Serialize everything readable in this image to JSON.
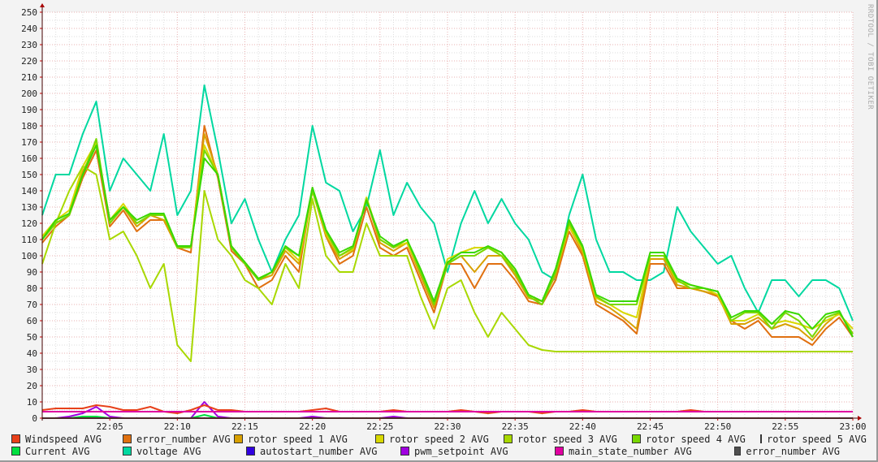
{
  "chart_data": {
    "type": "line",
    "title": "",
    "watermark": "RRDTOOL / TOBI OETIKER",
    "ylim": [
      0,
      250
    ],
    "yticks": [
      0,
      10,
      20,
      30,
      40,
      50,
      60,
      70,
      80,
      90,
      100,
      110,
      120,
      130,
      140,
      150,
      160,
      170,
      180,
      190,
      200,
      210,
      220,
      230,
      240,
      250
    ],
    "xlim_minutes": [
      0,
      60
    ],
    "xticks": [
      {
        "m": 5,
        "label": "22:05"
      },
      {
        "m": 10,
        "label": "22:10"
      },
      {
        "m": 15,
        "label": "22:15"
      },
      {
        "m": 20,
        "label": "22:20"
      },
      {
        "m": 25,
        "label": "22:25"
      },
      {
        "m": 30,
        "label": "22:30"
      },
      {
        "m": 35,
        "label": "22:35"
      },
      {
        "m": 40,
        "label": "22:40"
      },
      {
        "m": 45,
        "label": "22:45"
      },
      {
        "m": 50,
        "label": "22:50"
      },
      {
        "m": 55,
        "label": "22:55"
      },
      {
        "m": 60,
        "label": "23:00"
      }
    ],
    "grid": true,
    "x_minutes_step": 1,
    "series": [
      {
        "name": "Windspeed AVG",
        "color": "#e8401a",
        "values": [
          5,
          6,
          6,
          6,
          8,
          7,
          5,
          5,
          7,
          4,
          3,
          5,
          8,
          5,
          5,
          4,
          4,
          4,
          4,
          4,
          5,
          6,
          4,
          4,
          4,
          4,
          5,
          4,
          4,
          4,
          4,
          5,
          4,
          3,
          4,
          4,
          4,
          3,
          4,
          4,
          5,
          4,
          4,
          4,
          4,
          4,
          4,
          4,
          5,
          4,
          4,
          4,
          4,
          4,
          4,
          4,
          4,
          4,
          4,
          4,
          4
        ]
      },
      {
        "name": "error_number AVG",
        "color": "#e07010",
        "values": [
          108,
          118,
          125,
          148,
          165,
          118,
          128,
          115,
          122,
          122,
          105,
          102,
          180,
          148,
          103,
          95,
          80,
          85,
          100,
          90,
          142,
          112,
          95,
          100,
          130,
          105,
          100,
          105,
          85,
          65,
          95,
          95,
          80,
          95,
          95,
          85,
          72,
          70,
          85,
          115,
          100,
          70,
          65,
          60,
          52,
          95,
          95,
          80,
          80,
          78,
          75,
          60,
          55,
          60,
          50,
          50,
          50,
          45,
          55,
          62,
          50
        ]
      },
      {
        "name": "rotor speed 1 AVG",
        "color": "#d8a000",
        "values": [
          112,
          120,
          125,
          152,
          168,
          120,
          130,
          118,
          125,
          122,
          105,
          105,
          175,
          150,
          105,
          95,
          85,
          88,
          103,
          95,
          140,
          112,
          98,
          103,
          135,
          108,
          103,
          108,
          88,
          68,
          95,
          100,
          90,
          100,
          100,
          88,
          74,
          72,
          88,
          118,
          102,
          72,
          68,
          62,
          55,
          98,
          98,
          82,
          80,
          78,
          76,
          58,
          58,
          62,
          55,
          58,
          55,
          48,
          58,
          65,
          52
        ]
      },
      {
        "name": "rotor speed 2 AVG",
        "color": "#d8d800",
        "values": [
          112,
          122,
          128,
          155,
          170,
          122,
          132,
          120,
          125,
          125,
          106,
          106,
          168,
          150,
          106,
          96,
          86,
          90,
          105,
          97,
          140,
          114,
          100,
          104,
          136,
          110,
          105,
          108,
          90,
          70,
          98,
          102,
          105,
          105,
          102,
          90,
          76,
          72,
          90,
          118,
          104,
          74,
          70,
          65,
          62,
          100,
          100,
          84,
          82,
          80,
          76,
          60,
          60,
          64,
          58,
          60,
          58,
          55,
          60,
          64,
          55
        ]
      },
      {
        "name": "rotor speed 3 AVG",
        "color": "#a8d800",
        "values": [
          95,
          120,
          140,
          155,
          150,
          110,
          115,
          100,
          80,
          95,
          45,
          35,
          140,
          110,
          100,
          85,
          80,
          70,
          95,
          80,
          135,
          100,
          90,
          90,
          120,
          100,
          100,
          100,
          75,
          55,
          80,
          85,
          65,
          50,
          65,
          55,
          45,
          42,
          41,
          41,
          41,
          41,
          41,
          41,
          41,
          41,
          41,
          41,
          41,
          41,
          41,
          41,
          41,
          41,
          41,
          41,
          41,
          41,
          41,
          41,
          41
        ]
      },
      {
        "name": "rotor speed 4 AVG",
        "color": "#78d800",
        "values": [
          110,
          120,
          125,
          150,
          172,
          120,
          130,
          120,
          125,
          125,
          105,
          105,
          165,
          150,
          105,
          95,
          85,
          90,
          105,
          100,
          140,
          115,
          100,
          105,
          135,
          110,
          105,
          110,
          90,
          70,
          95,
          100,
          100,
          105,
          100,
          90,
          75,
          70,
          90,
          120,
          105,
          75,
          70,
          70,
          70,
          100,
          100,
          85,
          80,
          80,
          78,
          60,
          65,
          65,
          55,
          65,
          60,
          50,
          62,
          65,
          52
        ]
      },
      {
        "name": "rotor speed 5 AVG",
        "color": "#38d800",
        "values": [
          110,
          122,
          126,
          150,
          168,
          122,
          130,
          122,
          126,
          126,
          106,
          106,
          160,
          150,
          106,
          96,
          86,
          90,
          106,
          100,
          142,
          116,
          102,
          106,
          134,
          112,
          106,
          110,
          92,
          72,
          96,
          102,
          102,
          106,
          102,
          92,
          76,
          72,
          92,
          122,
          106,
          76,
          72,
          72,
          72,
          102,
          102,
          86,
          82,
          80,
          78,
          62,
          66,
          66,
          58,
          66,
          64,
          55,
          64,
          66,
          50
        ]
      },
      {
        "name": "Current AVG",
        "color": "#00e040",
        "values": [
          0,
          0,
          0,
          1,
          1,
          0,
          0,
          0,
          0,
          0,
          0,
          0,
          2,
          0,
          0,
          0,
          0,
          0,
          0,
          0,
          0,
          0,
          0,
          0,
          0,
          0,
          0,
          0,
          0,
          0,
          0,
          0,
          0,
          0,
          0,
          0,
          0,
          0,
          0,
          0,
          0,
          0,
          0,
          0,
          0,
          0,
          0,
          0,
          0,
          0,
          0,
          0,
          0,
          0,
          0,
          0,
          0,
          0,
          0,
          0,
          0
        ]
      },
      {
        "name": "voltage AVG",
        "color": "#00d8a0",
        "values": [
          125,
          150,
          150,
          175,
          195,
          140,
          160,
          150,
          140,
          175,
          125,
          140,
          205,
          165,
          120,
          135,
          110,
          90,
          110,
          125,
          180,
          145,
          140,
          115,
          130,
          165,
          125,
          145,
          130,
          120,
          90,
          120,
          140,
          120,
          135,
          120,
          110,
          90,
          85,
          125,
          150,
          110,
          90,
          90,
          85,
          85,
          90,
          130,
          115,
          105,
          95,
          100,
          80,
          65,
          85,
          85,
          75,
          85,
          85,
          80,
          60
        ]
      },
      {
        "name": "autostart_number AVG",
        "color": "#3000e0",
        "values": [
          0,
          0,
          0,
          0,
          0,
          0,
          0,
          0,
          0,
          0,
          0,
          0,
          0,
          0,
          0,
          0,
          0,
          0,
          0,
          0,
          0,
          0,
          0,
          0,
          0,
          0,
          0,
          0,
          0,
          0,
          0,
          0,
          0,
          0,
          0,
          0,
          0,
          0,
          0,
          0,
          0,
          0,
          0,
          0,
          0,
          0,
          0,
          0,
          0,
          0,
          0,
          0,
          0,
          0,
          0,
          0,
          0,
          0,
          0,
          0,
          0
        ]
      },
      {
        "name": "pwm_setpoint AVG",
        "color": "#a000e0",
        "values": [
          0,
          0,
          1,
          3,
          7,
          1,
          0,
          0,
          0,
          0,
          0,
          0,
          10,
          1,
          0,
          0,
          0,
          0,
          0,
          0,
          1,
          0,
          0,
          0,
          0,
          0,
          1,
          0,
          0,
          0,
          0,
          0,
          0,
          0,
          0,
          0,
          0,
          0,
          0,
          0,
          0,
          0,
          0,
          0,
          0,
          0,
          0,
          0,
          0,
          0,
          0,
          0,
          0,
          0,
          0,
          0,
          0,
          0,
          0,
          0,
          0
        ]
      },
      {
        "name": "main_state_number AVG",
        "color": "#e000a0",
        "values": [
          4,
          4,
          4,
          4,
          4,
          4,
          4,
          4,
          4,
          4,
          4,
          4,
          4,
          4,
          4,
          4,
          4,
          4,
          4,
          4,
          4,
          4,
          4,
          4,
          4,
          4,
          4,
          4,
          4,
          4,
          4,
          4,
          4,
          4,
          4,
          4,
          4,
          4,
          4,
          4,
          4,
          4,
          4,
          4,
          4,
          4,
          4,
          4,
          4,
          4,
          4,
          4,
          4,
          4,
          4,
          4,
          4,
          4,
          4,
          4,
          4
        ]
      },
      {
        "name": "error_number AVG",
        "color": "#505050",
        "values": [
          0,
          0,
          0,
          0,
          0,
          0,
          0,
          0,
          0,
          0,
          0,
          0,
          0,
          0,
          0,
          0,
          0,
          0,
          0,
          0,
          0,
          0,
          0,
          0,
          0,
          0,
          0,
          0,
          0,
          0,
          0,
          0,
          0,
          0,
          0,
          0,
          0,
          0,
          0,
          0,
          0,
          0,
          0,
          0,
          0,
          0,
          0,
          0,
          0,
          0,
          0,
          0,
          0,
          0,
          0,
          0,
          0,
          0,
          0,
          0,
          0
        ]
      }
    ]
  }
}
